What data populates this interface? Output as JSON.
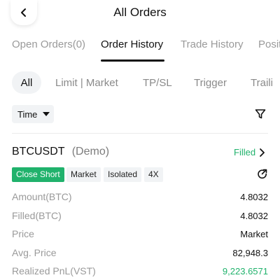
{
  "header": {
    "title": "All Orders",
    "back_icon": "chevron-left-icon"
  },
  "main_tabs": [
    {
      "label": "Open Orders(0)",
      "active": false
    },
    {
      "label": "Order History",
      "active": true
    },
    {
      "label": "Trade History",
      "active": false
    },
    {
      "label": "Posit",
      "active": false
    }
  ],
  "sub_filters": [
    {
      "label": "All",
      "active": true
    },
    {
      "label": "Limit | Market",
      "active": false
    },
    {
      "label": "TP/SL",
      "active": false
    },
    {
      "label": "Trigger",
      "active": false
    },
    {
      "label": "Traili",
      "active": false
    }
  ],
  "time_filter": {
    "label": "Time",
    "icon": "caret-down-icon"
  },
  "filter_icon": "filter-funnel-icon",
  "order": {
    "symbol": "BTCUSDT",
    "mode": "(Demo)",
    "status": "Filled",
    "tags": [
      "Close Short",
      "Market",
      "Isolated",
      "4X"
    ],
    "share_icon": "share-icon",
    "rows": [
      {
        "label": "Amount(BTC)",
        "value": "4.8032"
      },
      {
        "label": "Filled(BTC)",
        "value": "4.8032"
      },
      {
        "label": "Price",
        "value": "Market"
      },
      {
        "label": "Avg. Price",
        "value": "82,948.3"
      },
      {
        "label": "Realized PnL(VST)",
        "value": "9,223.6571"
      }
    ]
  },
  "colors": {
    "accent_green": "#20b26c",
    "muted_text": "#9a9a9a",
    "chip_bg": "#f1f3f5"
  }
}
